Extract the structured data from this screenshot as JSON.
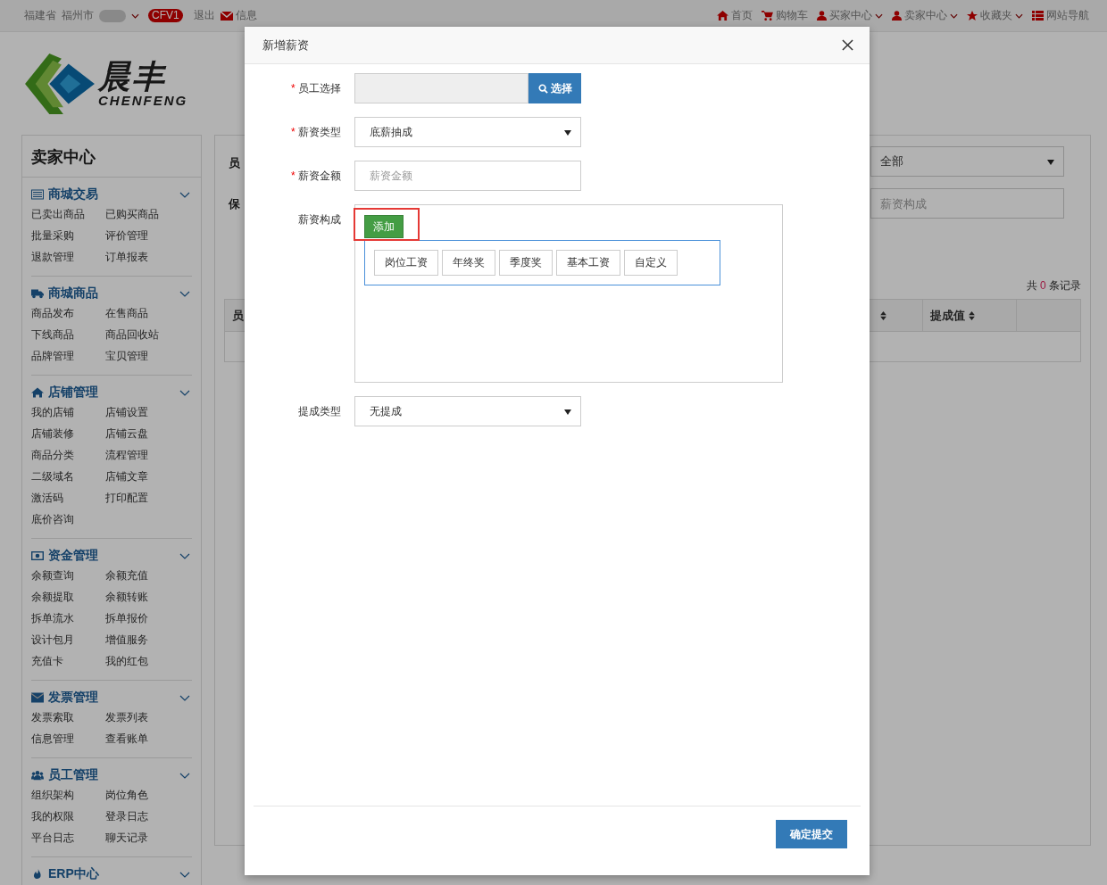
{
  "topbar": {
    "location": [
      "福建省",
      "福州市"
    ],
    "badge": "CFV1",
    "logout": "退出",
    "messages": "信息",
    "nav": [
      {
        "kind": "home",
        "label": "首页",
        "dropdown": false
      },
      {
        "kind": "cart",
        "label": "购物车",
        "dropdown": false
      },
      {
        "kind": "user",
        "label": "买家中心",
        "dropdown": true
      },
      {
        "kind": "user",
        "label": "卖家中心",
        "dropdown": true
      },
      {
        "kind": "star",
        "label": "收藏夹",
        "dropdown": true
      },
      {
        "kind": "list",
        "label": "网站导航",
        "dropdown": false
      }
    ]
  },
  "logo": {
    "name": "晨丰",
    "latin": "CHENFENG"
  },
  "sidebar": {
    "title": "卖家中心",
    "sections": [
      {
        "kind": "list",
        "title": "商城交易",
        "items": [
          "已卖出商品",
          "已购买商品",
          "批量采购",
          "评价管理",
          "退款管理",
          "订单报表"
        ]
      },
      {
        "kind": "truck",
        "title": "商城商品",
        "items": [
          "商品发布",
          "在售商品",
          "下线商品",
          "商品回收站",
          "品牌管理",
          "宝贝管理"
        ]
      },
      {
        "kind": "home",
        "title": "店铺管理",
        "items": [
          "我的店铺",
          "店铺设置",
          "店铺装修",
          "店铺云盘",
          "商品分类",
          "流程管理",
          "二级域名",
          "店铺文章",
          "激活码",
          "打印配置",
          "底价咨询"
        ]
      },
      {
        "kind": "money",
        "title": "资金管理",
        "items": [
          "余额查询",
          "余额充值",
          "余额提取",
          "余额转账",
          "拆单流水",
          "拆单报价",
          "设计包月",
          "增值服务",
          "充值卡",
          "我的红包"
        ]
      },
      {
        "kind": "mail",
        "title": "发票管理",
        "items": [
          "发票索取",
          "发票列表",
          "信息管理",
          "查看账单"
        ]
      },
      {
        "kind": "users",
        "title": "员工管理",
        "items": [
          "组织架构",
          "岗位角色",
          "我的权限",
          "登录日志",
          "平台日志",
          "聊天记录"
        ]
      },
      {
        "kind": "fire",
        "title": "ERP中心"
      }
    ]
  },
  "main": {
    "labels": [
      "员",
      "保"
    ],
    "filter": {
      "value": "全部"
    },
    "search": {
      "placeholder": "薪资构成"
    },
    "count": {
      "prefix": "共",
      "value": "0",
      "suffix": "条记录"
    },
    "table": {
      "columns": [
        {
          "label": "员",
          "sortable": false
        },
        {
          "sortable": true
        },
        {
          "label": "提成值",
          "sortable": true
        },
        {
          "sortable": false
        }
      ]
    }
  },
  "modal": {
    "title": "新增薪资",
    "fields": [
      {
        "kind": "picker",
        "label": "员工选择",
        "required_mark": "*",
        "button": "选择"
      },
      {
        "kind": "select",
        "label": "薪资类型",
        "required_mark": "*",
        "value": "底薪抽成"
      },
      {
        "kind": "input",
        "label": "薪资金额",
        "required_mark": "*",
        "placeholder": "薪资金额"
      },
      {
        "kind": "composer",
        "label": "薪资构成",
        "add_button": "添加",
        "highlighted": true,
        "options": [
          "岗位工资",
          "年终奖",
          "季度奖",
          "基本工资",
          "自定义"
        ]
      },
      {
        "kind": "select",
        "label": "提成类型",
        "value": "无提成"
      }
    ],
    "submit": "确定提交"
  }
}
